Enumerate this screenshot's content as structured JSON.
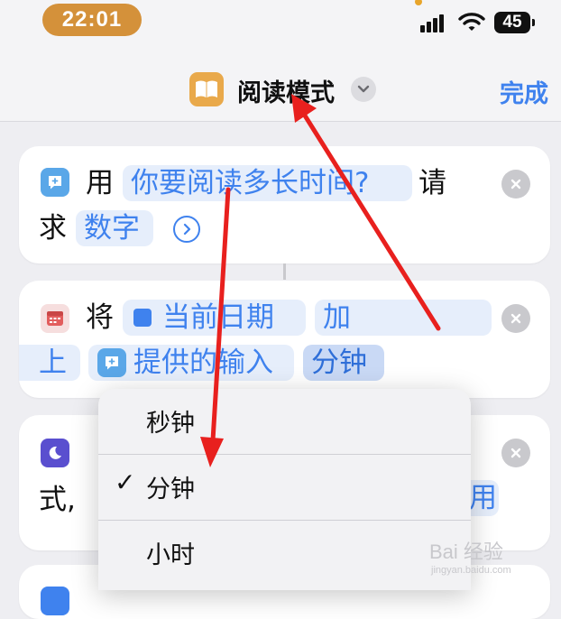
{
  "status_bar": {
    "time": "22:01",
    "battery": "45"
  },
  "nav": {
    "title": "阅读模式",
    "done_label": "完成",
    "app_icon": "book-icon",
    "title_menu_icon": "chevron-down-icon"
  },
  "actions": [
    {
      "icon": "message-bubble-icon",
      "verb": "用",
      "prompt_token": "你要阅读多长时间?",
      "after_token": "请",
      "line2_prefix": "求",
      "type_token": "数字"
    },
    {
      "icon": "calendar-icon",
      "verb": "将",
      "date_token": "当前日期",
      "operation_token": "加",
      "line2_prefix": "上",
      "input_token": "提供的输入",
      "unit_token": "分钟"
    },
    {
      "icon": "moon-icon",
      "line2_prefix": "式,",
      "partial_token_right": "用"
    }
  ],
  "unit_menu": {
    "items": [
      {
        "label": "秒钟",
        "checked": false
      },
      {
        "label": "分钟",
        "checked": true
      },
      {
        "label": "小时",
        "checked": false
      }
    ],
    "check_mark": "✓"
  },
  "watermark": {
    "brand": "Bai 经验",
    "url": "jingyan.baidu.com"
  },
  "colors": {
    "accent": "#3f82ee",
    "token_bg": "#e6eefb",
    "app_icon": "#e9a94b",
    "time_pill": "#d4913a",
    "annotation_arrow": "#e8201e"
  }
}
